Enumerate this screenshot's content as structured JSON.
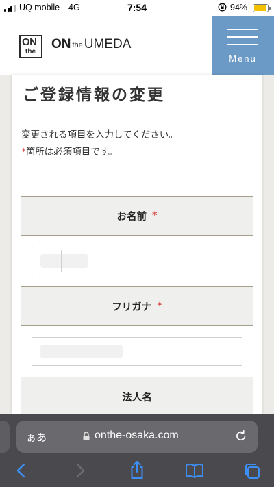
{
  "status_bar": {
    "carrier": "UQ mobile",
    "network": "4G",
    "time": "7:54",
    "battery_percent": "94%",
    "battery_level": 0.94,
    "battery_color": "#f2c200"
  },
  "header": {
    "logo_box_on": "ON",
    "logo_box_the": "the",
    "logo_on": "ON",
    "logo_the": "the",
    "logo_name": "UMEDA",
    "menu_label": "Menu",
    "menu_color": "#6b9ac6"
  },
  "content": {
    "title": "ご登録情報の変更",
    "intro": "変更される項目を入力してください。",
    "required_mark": "*",
    "required_note": "箇所は必須項目です。",
    "fields": [
      {
        "label": "お名前",
        "required": true,
        "value": ""
      },
      {
        "label": "フリガナ",
        "required": true,
        "value": ""
      },
      {
        "label": "法人名",
        "required": false
      }
    ]
  },
  "browser": {
    "aa_label": "ぁあ",
    "url": "onthe-osaka.com",
    "icons": [
      "back-icon",
      "forward-icon",
      "share-icon",
      "bookmarks-icon",
      "tabs-icon",
      "lock-icon",
      "reload-icon"
    ]
  }
}
